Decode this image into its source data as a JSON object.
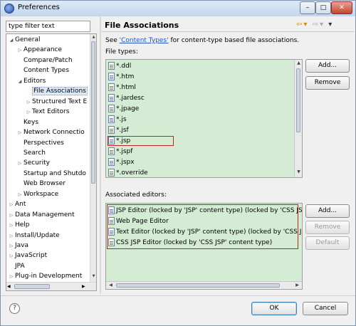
{
  "window": {
    "title": "Preferences",
    "controls": {
      "minimize": "–",
      "maximize": "□",
      "close": "✕"
    }
  },
  "filter": {
    "value": "type filter text"
  },
  "tree": {
    "items": [
      {
        "label": "General",
        "indent": 0,
        "tri": "◢"
      },
      {
        "label": "Appearance",
        "indent": 1,
        "tri": "▷"
      },
      {
        "label": "Compare/Patch",
        "indent": 1,
        "tri": ""
      },
      {
        "label": "Content Types",
        "indent": 1,
        "tri": ""
      },
      {
        "label": "Editors",
        "indent": 1,
        "tri": "◢"
      },
      {
        "label": "File Associations",
        "indent": 2,
        "tri": "",
        "selected": true
      },
      {
        "label": "Structured Text E",
        "indent": 2,
        "tri": "▷"
      },
      {
        "label": "Text Editors",
        "indent": 2,
        "tri": "▷"
      },
      {
        "label": "Keys",
        "indent": 1,
        "tri": ""
      },
      {
        "label": "Network Connectio",
        "indent": 1,
        "tri": "▷"
      },
      {
        "label": "Perspectives",
        "indent": 1,
        "tri": ""
      },
      {
        "label": "Search",
        "indent": 1,
        "tri": ""
      },
      {
        "label": "Security",
        "indent": 1,
        "tri": "▷"
      },
      {
        "label": "Startup and Shutdo",
        "indent": 1,
        "tri": ""
      },
      {
        "label": "Web Browser",
        "indent": 1,
        "tri": ""
      },
      {
        "label": "Workspace",
        "indent": 1,
        "tri": "▷"
      },
      {
        "label": "Ant",
        "indent": 0,
        "tri": "▷"
      },
      {
        "label": "Data Management",
        "indent": 0,
        "tri": "▷"
      },
      {
        "label": "Help",
        "indent": 0,
        "tri": "▷"
      },
      {
        "label": "Install/Update",
        "indent": 0,
        "tri": "▷"
      },
      {
        "label": "Java",
        "indent": 0,
        "tri": "▷"
      },
      {
        "label": "JavaScript",
        "indent": 0,
        "tri": "▷"
      },
      {
        "label": "JPA",
        "indent": 0,
        "tri": ""
      },
      {
        "label": "Plug-in Development",
        "indent": 0,
        "tri": "▷"
      }
    ]
  },
  "page": {
    "title": "File Associations"
  },
  "description": {
    "prefix": "See ",
    "link": "'Content Types'",
    "suffix": " for content-type based file associations."
  },
  "file_types": {
    "label": "File types:",
    "items": [
      "*.ddl",
      "*.htm",
      "*.html",
      "*.jardesc",
      "*.jpage",
      "*.js",
      "*.jsf",
      "*.jsp",
      "*.jspf",
      "*.jspx",
      "*.override"
    ],
    "highlighted": "*.jsp",
    "add_label": "Add...",
    "remove_label": "Remove"
  },
  "associated_editors": {
    "label": "Associated editors:",
    "items": [
      "JSP Editor (locked by 'JSP' content type) (locked by 'CSS JSP'",
      "Web Page Editor",
      "Text Editor (locked by 'JSP' content type) (locked by 'CSS JSP",
      "CSS JSP Editor (locked by 'CSS JSP' content type)"
    ],
    "add_label": "Add...",
    "remove_label": "Remove",
    "default_label": "Default"
  },
  "footer": {
    "help": "?",
    "ok_label": "OK",
    "cancel_label": "Cancel"
  },
  "colors": {
    "list_background": "#d5ecd4",
    "highlight_border": "#c42020",
    "link": "#1f54c5"
  }
}
